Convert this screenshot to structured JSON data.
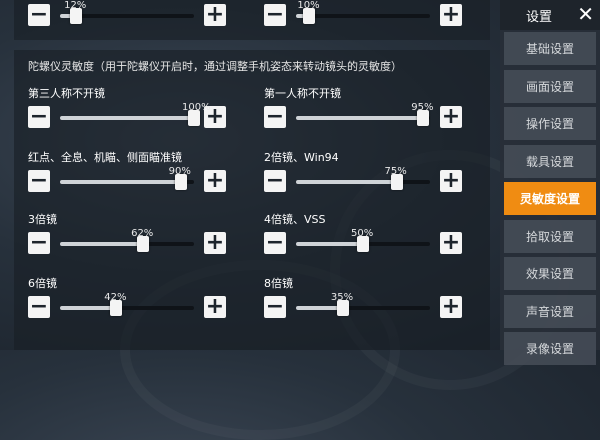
{
  "colors": {
    "accent": "#f08c12",
    "panel": "#1b2128",
    "button": "#f4f4f4"
  },
  "top_sliders": [
    {
      "value_text": "12%",
      "value": 12
    },
    {
      "value_text": "10%",
      "value": 10
    }
  ],
  "section_title": "陀螺仪灵敏度（用于陀螺仪开启时，通过调整手机姿态来转动镜头的灵敏度）",
  "sliders": [
    {
      "label": "第三人称不开镜",
      "value_text": "100%",
      "value": 100
    },
    {
      "label": "第一人称不开镜",
      "value_text": "95%",
      "value": 95
    },
    {
      "label": "红点、全息、机瞄、侧面瞄准镜",
      "value_text": "90%",
      "value": 90
    },
    {
      "label": "2倍镜、Win94",
      "value_text": "75%",
      "value": 75
    },
    {
      "label": "3倍镜",
      "value_text": "62%",
      "value": 62
    },
    {
      "label": "4倍镜、VSS",
      "value_text": "50%",
      "value": 50
    },
    {
      "label": "6倍镜",
      "value_text": "42%",
      "value": 42
    },
    {
      "label": "8倍镜",
      "value_text": "35%",
      "value": 35
    }
  ],
  "button_glyphs": {
    "minus": "−",
    "plus": "+"
  },
  "sidebar": {
    "title": "设置",
    "close_glyph": "✕",
    "items": [
      {
        "label": "基础设置"
      },
      {
        "label": "画面设置"
      },
      {
        "label": "操作设置"
      },
      {
        "label": "载具设置"
      },
      {
        "label": "灵敏度设置",
        "active": true
      },
      {
        "label": "拾取设置"
      },
      {
        "label": "效果设置"
      },
      {
        "label": "声音设置"
      },
      {
        "label": "录像设置"
      }
    ]
  }
}
